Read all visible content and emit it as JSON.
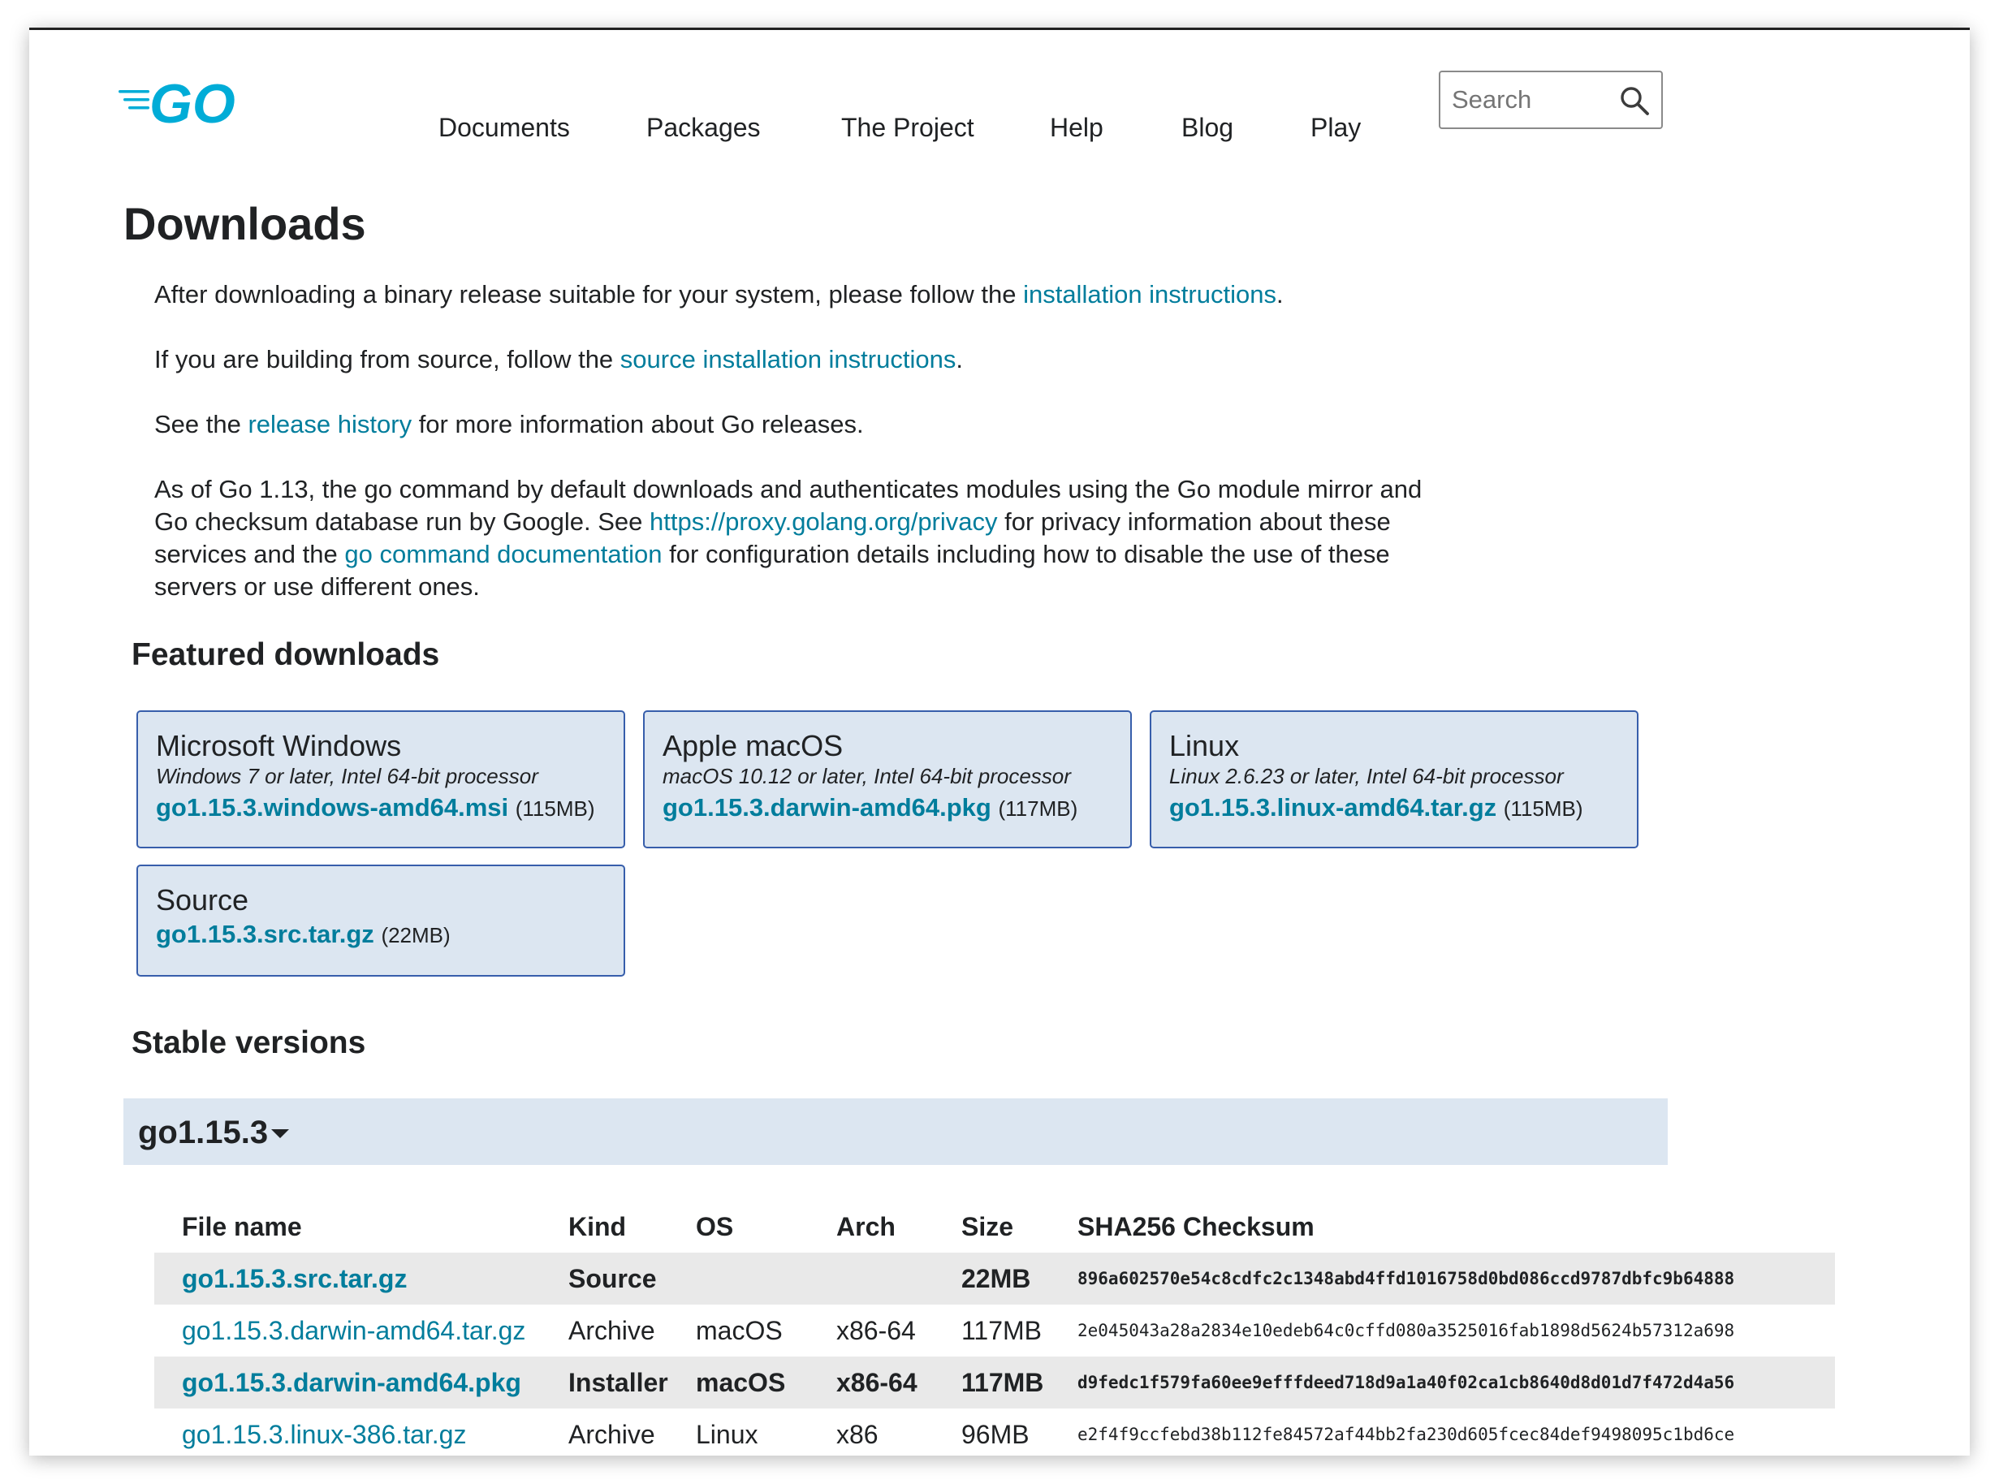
{
  "header": {
    "logo_text": "GO",
    "nav": [
      {
        "label": "Documents"
      },
      {
        "label": "Packages"
      },
      {
        "label": "The Project"
      },
      {
        "label": "Help"
      },
      {
        "label": "Blog"
      },
      {
        "label": "Play"
      }
    ],
    "search": {
      "placeholder": "Search",
      "value": ""
    }
  },
  "main": {
    "title": "Downloads",
    "intro": {
      "p1_before": "After downloading a binary release suitable for your system, please follow the ",
      "p1_link": "installation instructions",
      "p1_after": ".",
      "p2_before": "If you are building from source, follow the ",
      "p2_link": "source installation instructions",
      "p2_after": ".",
      "p3_before": "See the ",
      "p3_link": "release history",
      "p3_after": " for more information about Go releases.",
      "p4_a": "As of Go 1.13, the go command by default downloads and authenticates modules using the Go module mirror and Go checksum database run by Google. See ",
      "p4_link1": "https://proxy.golang.org/privacy",
      "p4_b": " for privacy information about these services and the ",
      "p4_link2": "go command documentation",
      "p4_c": " for configuration details including how to disable the use of these servers or use different ones."
    },
    "featured": {
      "heading": "Featured downloads",
      "cards": [
        {
          "title": "Microsoft Windows",
          "subtitle": "Windows 7 or later, Intel 64-bit processor",
          "file": "go1.15.3.windows-amd64.msi",
          "size": "(115MB)"
        },
        {
          "title": "Apple macOS",
          "subtitle": "macOS 10.12 or later, Intel 64-bit processor",
          "file": "go1.15.3.darwin-amd64.pkg",
          "size": "(117MB)"
        },
        {
          "title": "Linux",
          "subtitle": "Linux 2.6.23 or later, Intel 64-bit processor",
          "file": "go1.15.3.linux-amd64.tar.gz",
          "size": "(115MB)"
        },
        {
          "title": "Source",
          "subtitle": "",
          "file": "go1.15.3.src.tar.gz",
          "size": "(22MB)"
        }
      ]
    },
    "stable": {
      "heading": "Stable versions",
      "version": "go1.15.3",
      "columns": [
        "File name",
        "Kind",
        "OS",
        "Arch",
        "Size",
        "SHA256 Checksum"
      ],
      "rows": [
        {
          "file": "go1.15.3.src.tar.gz",
          "kind": "Source",
          "os": "",
          "arch": "",
          "size": "22MB",
          "sha": "896a602570e54c8cdfc2c1348abd4ffd1016758d0bd086ccd9787dbfc9b64888"
        },
        {
          "file": "go1.15.3.darwin-amd64.tar.gz",
          "kind": "Archive",
          "os": "macOS",
          "arch": "x86-64",
          "size": "117MB",
          "sha": "2e045043a28a2834e10edeb64c0cffd080a3525016fab1898d5624b57312a698"
        },
        {
          "file": "go1.15.3.darwin-amd64.pkg",
          "kind": "Installer",
          "os": "macOS",
          "arch": "x86-64",
          "size": "117MB",
          "sha": "d9fedc1f579fa60ee9efffdeed718d9a1a40f02ca1cb8640d8d01d7f472d4a56"
        },
        {
          "file": "go1.15.3.linux-386.tar.gz",
          "kind": "Archive",
          "os": "Linux",
          "arch": "x86",
          "size": "96MB",
          "sha": "e2f4f9ccfebd38b112fe84572af44bb2fa230d605fcec84def9498095c1bd6ce"
        }
      ]
    }
  },
  "colors": {
    "link": "#007d9c",
    "card_bg": "#dce6f1",
    "card_border": "#375eab",
    "logo": "#00acd7"
  }
}
